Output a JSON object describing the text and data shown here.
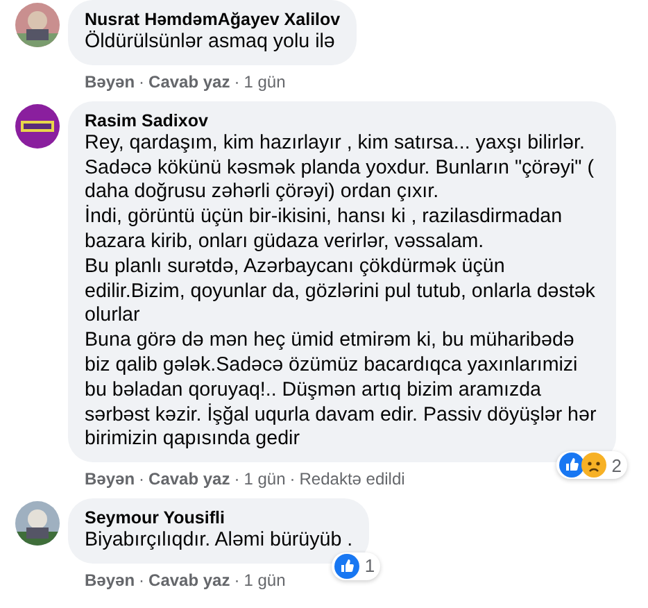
{
  "comments": [
    {
      "avatar": {
        "kind": "picture"
      },
      "author": "Nusrat HəmdəmAğayev Xalilov",
      "paragraphs": [
        "Öldürülsünlər asmaq yolu ilə"
      ],
      "actions": [
        {
          "label": "Bəyən",
          "kind": "link"
        },
        {
          "separator": "·",
          "label": "Cavab yaz",
          "kind": "link"
        },
        {
          "separator": "·",
          "label": "1 gün",
          "kind": "time"
        }
      ]
    },
    {
      "avatar": {
        "kind": "picture"
      },
      "author": "Rasim Sadixov",
      "paragraphs": [
        "Rey, qardaşım, kim hazırlayır , kim satırsa... yaxşı bilirlər. Sadəcə kökünü kəsmək planda yoxdur. Bunların \"çörəyi\" ( daha doğrusu zəhərli çörəyi) ordan çıxır.",
        "İndi, görüntü üçün bir-ikisini, hansı ki , razilasdirmadan bazara kirib, onları güdaza verirlər, vəssalam.",
        "Bu planlı surətdə, Azərbaycanı çökdürmək üçün edilir.Bizim, qoyunlar da, gözlərini pul tutub, onlarla dəstək olurlar",
        "Buna görə də mən heç ümid etmirəm ki, bu müharibədə biz qalib gələk.Sadəcə özümüz bacardıqca yaxınlarımizi bu bəladan qoruyaq!.. Düşmən artıq bizim aramızda sərbəst kəzir. İşğal uqurla davam edir. Passiv döyüşlər hər birimizin qapısında gedir"
      ],
      "actions": [
        {
          "label": "Bəyən",
          "kind": "link"
        },
        {
          "separator": "·",
          "label": "Cavab yaz",
          "kind": "link"
        },
        {
          "separator": "·",
          "label": "1 gün",
          "kind": "time"
        },
        {
          "separator": "·",
          "label": "Redaktə edildi",
          "kind": "note"
        }
      ],
      "reactions": [
        {
          "kind": "like"
        },
        {
          "kind": "sad"
        }
      ],
      "reaction_count": "2"
    },
    {
      "avatar": {
        "kind": "picture"
      },
      "author": "Seymour Yousifli",
      "paragraphs": [
        "Biyabırçılıqdır. Aləmi bürüyüb ."
      ],
      "actions": [
        {
          "label": "Bəyən",
          "kind": "link"
        },
        {
          "separator": "·",
          "label": "Cavab yaz",
          "kind": "link"
        },
        {
          "separator": "·",
          "label": "1 gün",
          "kind": "time"
        }
      ],
      "reactions": [
        {
          "kind": "like"
        }
      ],
      "reaction_count": "1"
    }
  ]
}
